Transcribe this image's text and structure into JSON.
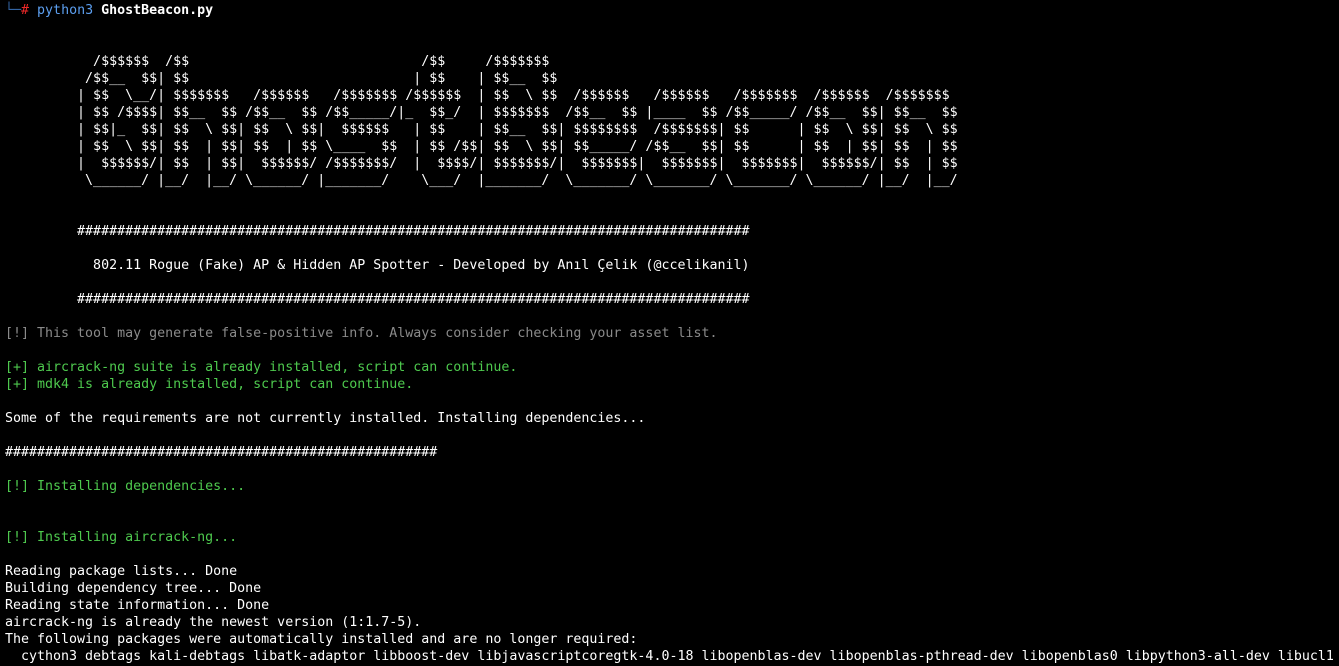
{
  "colors": {
    "background": "#000000",
    "text": "#ffffff",
    "info_gray": "#8a8a8a",
    "success_green": "#4ec94e",
    "prompt_red": "#ef2929",
    "prompt_blue": "#5c9ff0"
  },
  "prompt": {
    "corner": "└─",
    "hash": "#",
    "command": "python3",
    "argument": "GhostBeacon.py"
  },
  "banner": {
    "ascii_art": [
      "           /$$$$$$  /$$                             /$$     /$$$$$$$",
      "          /$$__  $$| $$                            | $$    | $$__  $$",
      "         | $$  \\__/| $$$$$$$   /$$$$$$   /$$$$$$$ /$$$$$$  | $$  \\ $$  /$$$$$$   /$$$$$$   /$$$$$$$  /$$$$$$  /$$$$$$$",
      "         | $$ /$$$$| $$__  $$ /$$__  $$ /$$_____/|_  $$_/  | $$$$$$$  /$$__  $$ |____  $$ /$$_____/ /$$__  $$| $$__  $$",
      "         | $$|_  $$| $$  \\ $$| $$  \\ $$|  $$$$$$   | $$    | $$__  $$| $$$$$$$$  /$$$$$$$| $$      | $$  \\ $$| $$  \\ $$",
      "         | $$  \\ $$| $$  | $$| $$  | $$ \\____  $$  | $$ /$$| $$  \\ $$| $$_____/ /$$__  $$| $$      | $$  | $$| $$  | $$",
      "         |  $$$$$$/| $$  | $$|  $$$$$$/ /$$$$$$$/  |  $$$$/| $$$$$$$/|  $$$$$$$|  $$$$$$$|  $$$$$$$|  $$$$$$/| $$  | $$",
      "          \\______/ |__/  |__/ \\______/ |_______/    \\___/  |_______/  \\_______/ \\_______/ \\_______/ \\______/ |__/  |__/"
    ],
    "separator": "         ####################################################################################",
    "subtitle": "           802.11 Rogue (Fake) AP & Hidden AP Spotter - Developed by Anıl Çelik (@ccelikanil)"
  },
  "output": {
    "warning_false_positive": "[!] This tool may generate false-positive info. Always consider checking your asset list.",
    "aircrack_installed": "[+] aircrack-ng suite is already installed, script can continue.",
    "mdk4_installed": "[+] mdk4 is already installed, script can continue.",
    "requirements_note": "Some of the requirements are not currently installed. Installing dependencies...",
    "short_separator": "######################################################",
    "installing_deps": "[!] Installing dependencies...",
    "installing_aircrack": "[!] Installing aircrack-ng...",
    "apt_lines": [
      "Reading package lists... Done",
      "Building dependency tree... Done",
      "Reading state information... Done",
      "aircrack-ng is already the newest version (1:1.7-5).",
      "The following packages were automatically installed and are no longer required:",
      "  cython3 debtags kali-debtags libatk-adaptor libboost-dev libjavascriptcoregtk-4.0-18 libopenblas-dev libopenblas-pthread-dev libopenblas0 libpython3-all-dev libucl1"
    ]
  }
}
